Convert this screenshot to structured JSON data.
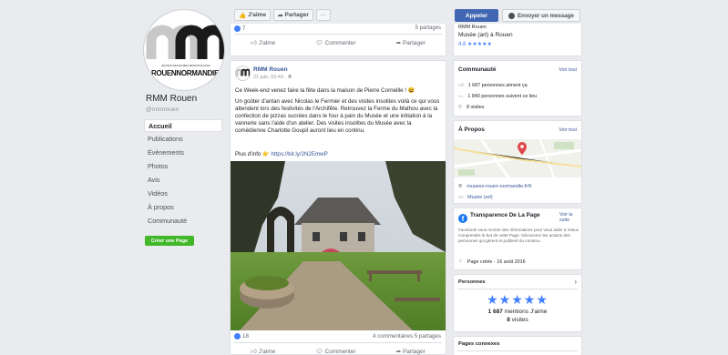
{
  "page": {
    "name": "RMM Rouen",
    "handle": "@rmmrouen",
    "logo_line1": "RÉUNION DES MUSÉES MÉTROPOLITAINS",
    "logo_line2": "ROUENNORMANDIE",
    "create_page_label": "Créer une Page"
  },
  "nav": [
    "Accueil",
    "Publications",
    "Évènements",
    "Photos",
    "Avis",
    "Vidéos",
    "À propos",
    "Communauté"
  ],
  "top_bar": {
    "like_label": "J'aime",
    "share_label": "Partager",
    "more_label": "···"
  },
  "prev_post": {
    "reactions": "7",
    "shares": "5 partages"
  },
  "actions": {
    "like": "J'aime",
    "comment": "Commenter",
    "share": "Partager"
  },
  "post": {
    "author": "RMM Rouen",
    "date": "21 juin, 02:43 · ",
    "line1": "Ce Week-end venez faire la fête dans la maison de Pierre Corneille ! 😆",
    "body": "Un goûter d'antan avec Nicolas le Fermier et des visites insolites voilà ce qui vous attendent lors des festivités de l'Archifête. Retrouvez la Ferme du Mathou avec la confection de pizzas sucrées dans le four à pain du Musée et une initiation à la vannerie sans l'aide d'un atelier. Des visites insolites du Musée avec la comédienne Charlotte Goupil auront lieu en continu.",
    "more_prefix": "Plus d'info 👉 ",
    "link": "https://bit.ly/2N2EmwP",
    "reactions": "18",
    "stats": "4 commentaires  5 partages"
  },
  "sidebar": {
    "call_label": "Appeler",
    "message_label": "Envoyer un message",
    "header_name": "RMM Rouen",
    "category": "Musée (art) à Rouen",
    "rating": "4.8 ★★★★★",
    "community": {
      "title": "Communauté",
      "see_all": "Voir tout",
      "likes": "1 687 personnes aiment ça",
      "follows": "1 840 personnes suivent ce lieu",
      "visits": "8 visites"
    },
    "about": {
      "title": "À Propos",
      "see_all": "Voir tout",
      "website": "musees-rouen-normandie.fr/fr",
      "category": "Musée (art)"
    },
    "transparency": {
      "title": "Transparence De La Page",
      "see_more": "Voir la suite",
      "text": "Facebook vous montre des informations pour vous aider à mieux comprendre le but de cette Page. Découvrez les actions des personnes qui gèrent et publient du contenu.",
      "created": "Page créée - 16 août 2016"
    },
    "people": {
      "title": "Personnes",
      "stars": "★★★★★",
      "mentions_count": "1 687",
      "mentions_label": " mentions J'aime",
      "visits_count": "8",
      "visits_label": " visites"
    },
    "related_title": "Pages connexes"
  },
  "colors": {
    "fb_blue": "#4267b2",
    "link_blue": "#385898",
    "green": "#42b72a",
    "star_blue": "#4080ff"
  }
}
